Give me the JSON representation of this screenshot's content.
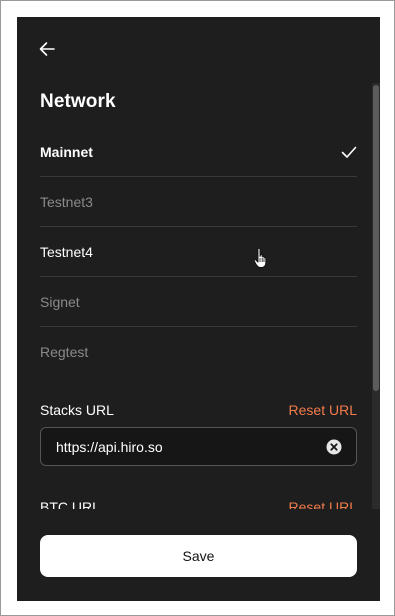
{
  "header": {
    "back_icon": "arrow-left-icon",
    "title": "Network"
  },
  "networks": [
    {
      "label": "Mainnet",
      "selected": true
    },
    {
      "label": "Testnet3",
      "selected": false
    },
    {
      "label": "Testnet4",
      "selected": false
    },
    {
      "label": "Signet",
      "selected": false
    },
    {
      "label": "Regtest",
      "selected": false
    }
  ],
  "stacks_url": {
    "label": "Stacks URL",
    "reset_label": "Reset URL",
    "value": "https://api.hiro.so",
    "clear_icon": "close-circle-icon"
  },
  "btc_url": {
    "label": "BTC URL",
    "reset_label": "Reset URL"
  },
  "footer": {
    "save_label": "Save"
  },
  "colors": {
    "background": "#1e1e1e",
    "accent": "#f27c4a",
    "text_primary": "#ffffff",
    "text_muted": "#8a8a8a"
  }
}
